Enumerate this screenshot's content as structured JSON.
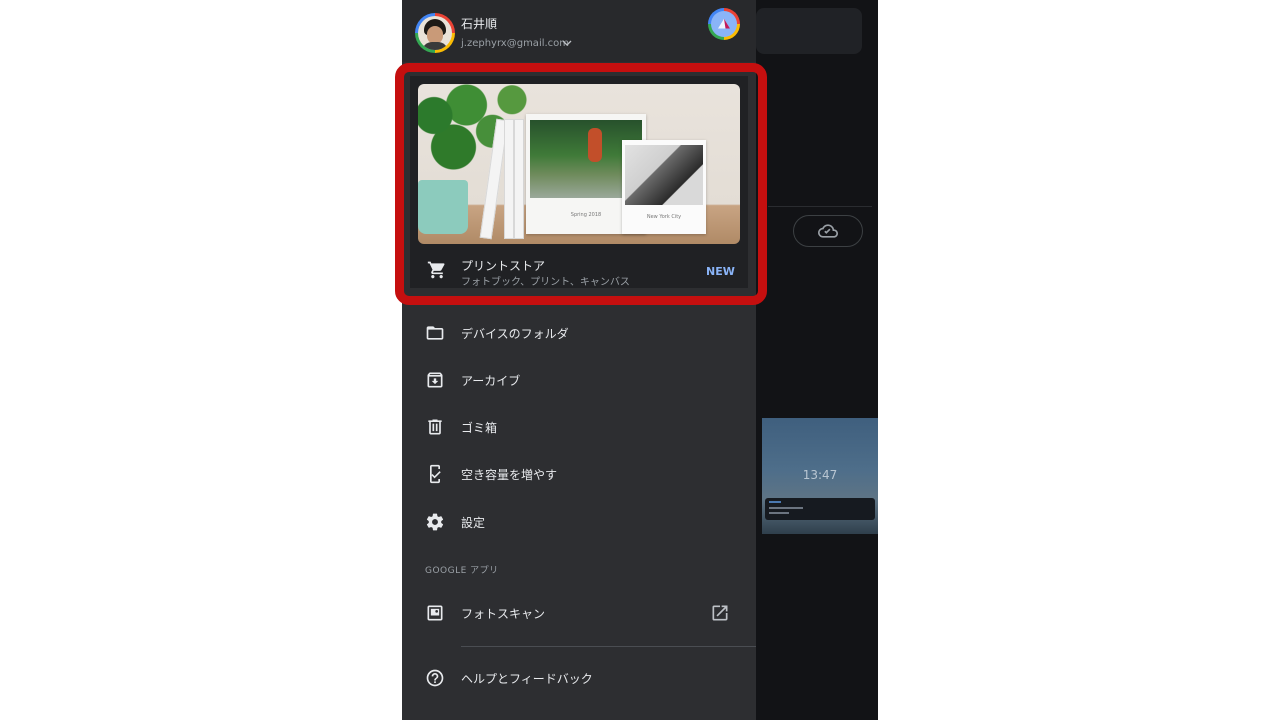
{
  "account": {
    "name": "石井順",
    "email": "j.zephyrx@gmail.com"
  },
  "promo": {
    "title": "プリントストア",
    "subtitle": "フォトブック、プリント、キャンバス",
    "badge": "NEW",
    "image_caption_1": "Spring 2018",
    "image_caption_2": "New York City"
  },
  "menu": [
    {
      "label": "デバイスのフォルダ",
      "icon": "folder-icon"
    },
    {
      "label": "アーカイブ",
      "icon": "archive-icon"
    },
    {
      "label": "ゴミ箱",
      "icon": "trash-icon"
    },
    {
      "label": "空き容量を増やす",
      "icon": "free-up-space-icon"
    },
    {
      "label": "設定",
      "icon": "settings-icon"
    }
  ],
  "google_apps": {
    "section_label": "GOOGLE アプリ",
    "items": [
      {
        "label": "フォトスキャン",
        "icon": "photoscan-icon",
        "trailing_icon": "open-external-icon"
      }
    ]
  },
  "help": {
    "label": "ヘルプとフィードバック",
    "icon": "help-icon"
  },
  "background_app": {
    "thumbnail_time": "13:47"
  },
  "colors": {
    "drawer_bg": "#2d2e31",
    "card_bg": "#202124",
    "accent": "#8ab4f8",
    "highlight": "#c50f0f"
  }
}
